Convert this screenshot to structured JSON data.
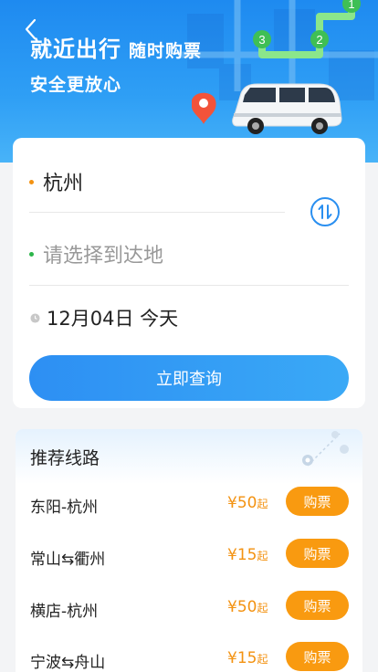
{
  "hero": {
    "title": "就近出行",
    "subtitle": "随时购票",
    "line2": "安全更放心"
  },
  "search": {
    "from": "杭州",
    "to_placeholder": "请选择到达地",
    "date": "12月04日 今天",
    "query_button": "立即查询"
  },
  "recommend": {
    "title": "推荐线路",
    "price_suffix": "起",
    "buy_label": "购票",
    "routes": [
      {
        "name": "东阳-杭州",
        "price": "¥50"
      },
      {
        "name": "常山⇆衢州",
        "price": "¥15"
      },
      {
        "name": "横店-杭州",
        "price": "¥50"
      },
      {
        "name": "宁波⇆舟山",
        "price": "¥15"
      }
    ]
  },
  "colors": {
    "primary_blue": "#2a8ff0",
    "price_orange": "#f39211",
    "buy_button": "#f99a10",
    "from_dot": "#f39211",
    "to_dot": "#2cb54a"
  }
}
